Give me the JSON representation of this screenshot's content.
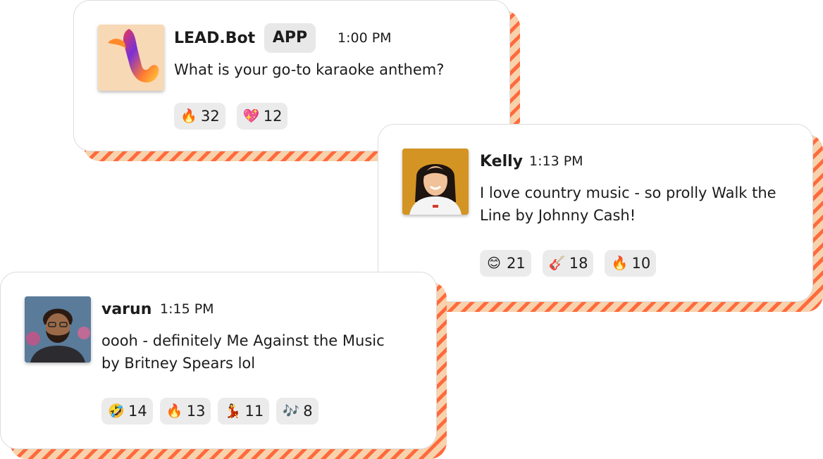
{
  "messages": [
    {
      "name": "LEAD.Bot",
      "badge": "APP",
      "time": "1:00 PM",
      "text": "What is your go-to karaoke anthem?",
      "reactions": [
        {
          "emoji": "🔥",
          "count": "32"
        },
        {
          "emoji": "💖",
          "count": "12"
        }
      ]
    },
    {
      "name": "Kelly",
      "time": "1:13 PM",
      "text_lines": [
        "I love country music - so prolly Walk the",
        "Line by Johnny Cash!"
      ],
      "reactions": [
        {
          "emoji": "😊",
          "count": "21"
        },
        {
          "emoji": "🎸",
          "count": "18"
        },
        {
          "emoji": "🔥",
          "count": "10"
        }
      ]
    },
    {
      "name": "varun",
      "time": "1:15 PM",
      "text_lines": [
        "oooh - definitely Me Against the Music",
        "by Britney Spears lol"
      ],
      "reactions": [
        {
          "emoji": "🤣",
          "count": "14"
        },
        {
          "emoji": "🔥",
          "count": "13"
        },
        {
          "emoji": "💃",
          "count": "11"
        },
        {
          "emoji": "🎶",
          "count": "8"
        }
      ]
    }
  ]
}
